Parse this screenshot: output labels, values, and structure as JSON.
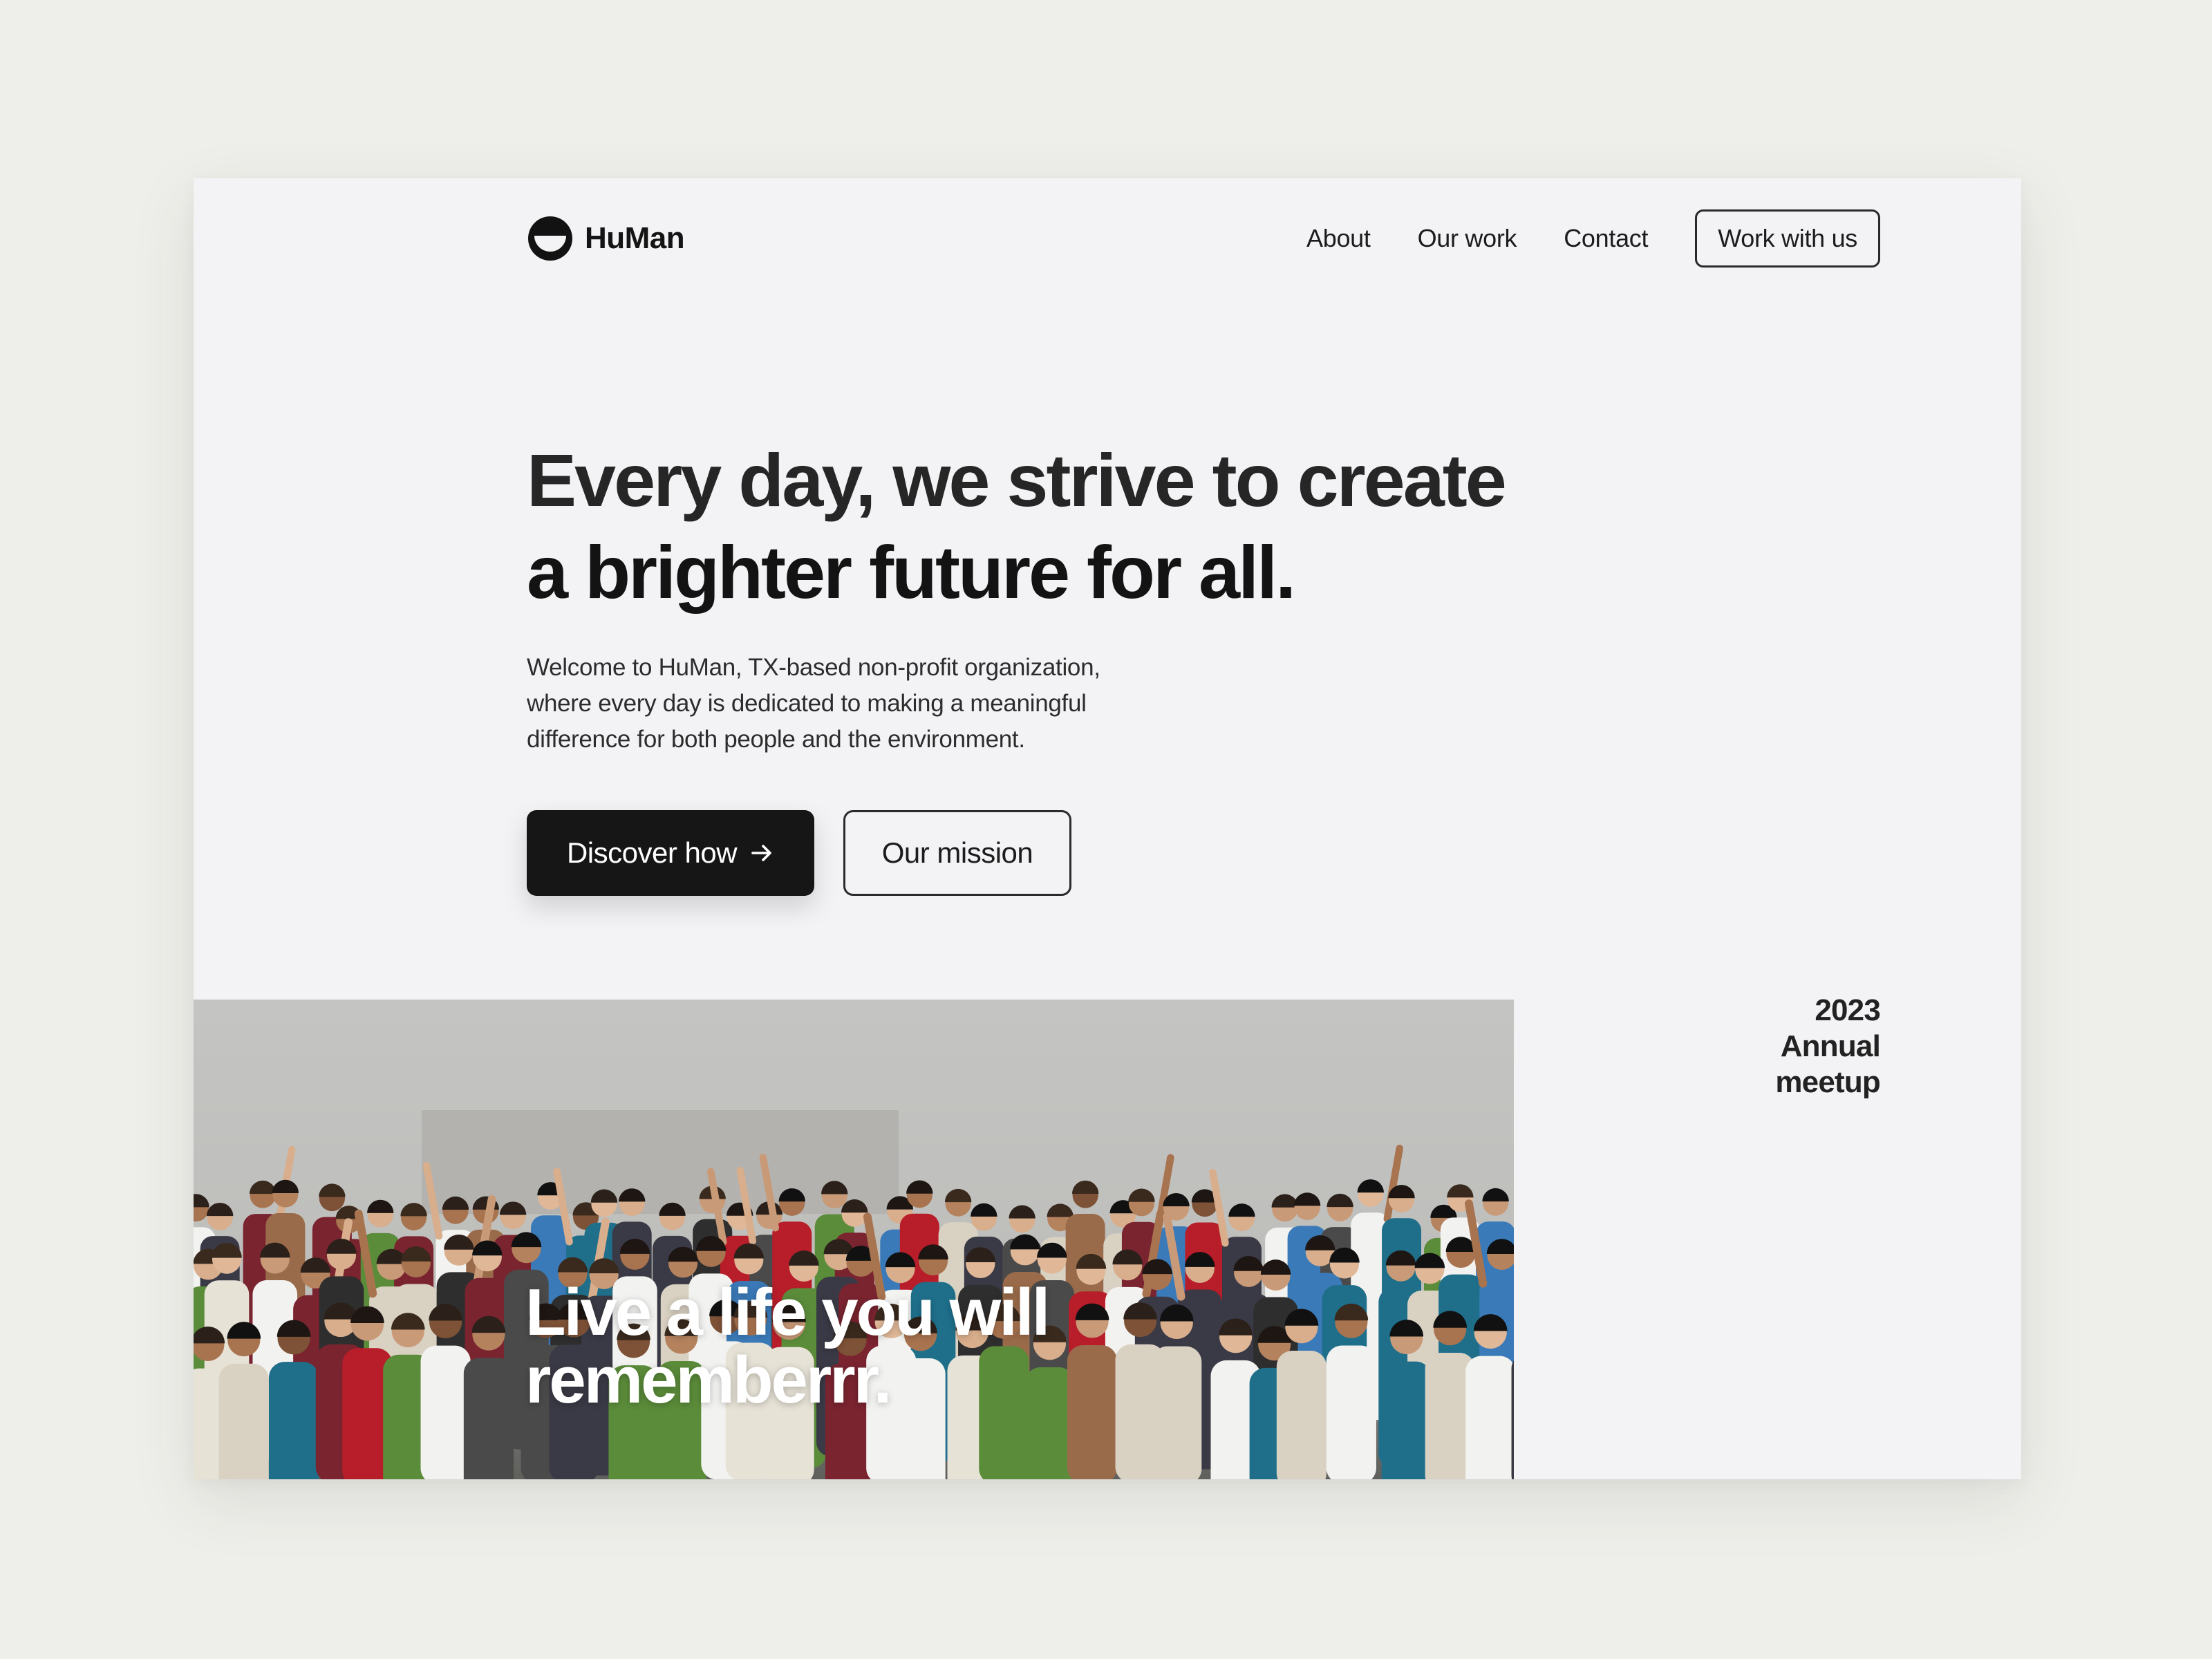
{
  "brand": {
    "name": "HuMan",
    "logo_icon": "smile-logo-icon"
  },
  "nav": {
    "links": [
      "About",
      "Our work",
      "Contact"
    ],
    "cta_label": "Work with us"
  },
  "hero": {
    "title_line_1": "Every day, we strive to create",
    "title_line_2": "a brighter future for all.",
    "description_lines": [
      "Welcome to HuMan, TX-based non-profit organization,",
      "where every day is dedicated to making a meaningful",
      "difference for both people and the environment."
    ],
    "primary_button": {
      "label": "Discover how",
      "icon": "arrow-right-icon"
    },
    "secondary_button": {
      "label": "Our mission"
    }
  },
  "photo": {
    "caption_line_1": "Live a life you will",
    "caption_line_2": "rememberrr."
  },
  "meetup": {
    "lines": [
      "2023",
      "Annual",
      "meetup"
    ]
  },
  "colors": {
    "page_background": "#eeefea",
    "card_background": "#f3f3f6",
    "primary_button": "#161616",
    "text_dark": "#1c1c1c"
  }
}
